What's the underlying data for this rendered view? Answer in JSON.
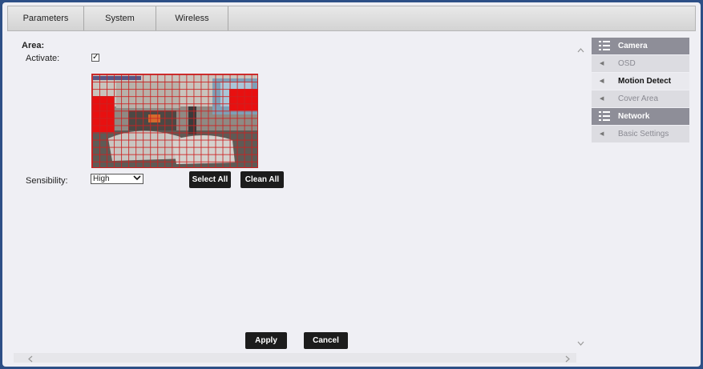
{
  "tabs": [
    {
      "label": "Parameters"
    },
    {
      "label": "System"
    },
    {
      "label": "Wireless"
    }
  ],
  "area": {
    "title": "Area:",
    "activate_label": "Activate:",
    "activate_checked": true,
    "check_glyph": "✓",
    "sensibility_label": "Sensibility:",
    "sensibility_value": "High",
    "select_all_label": "Select All",
    "clean_all_label": "Clean All",
    "grid": {
      "cols": 23,
      "rows": 13
    },
    "selected_regions": [
      {
        "name": "left-region",
        "cols": [
          0,
          2
        ],
        "rows": [
          3,
          7
        ]
      },
      {
        "name": "right-region",
        "cols": [
          19,
          22
        ],
        "rows": [
          2,
          4
        ]
      }
    ]
  },
  "actions": {
    "apply_label": "Apply",
    "cancel_label": "Cancel"
  },
  "menu": {
    "camera_header": "Camera",
    "items_camera": [
      {
        "label": "OSD",
        "active": false
      },
      {
        "label": "Motion Detect",
        "active": true
      },
      {
        "label": "Cover Area",
        "active": false
      }
    ],
    "network_header": "Network",
    "items_network": [
      {
        "label": "Basic Settings",
        "active": false
      }
    ]
  },
  "colors": {
    "accent_red": "#e81010",
    "button_dark": "#1c1c1c",
    "frame_border": "#2d4f86",
    "menu_header": "#8e8e98"
  }
}
